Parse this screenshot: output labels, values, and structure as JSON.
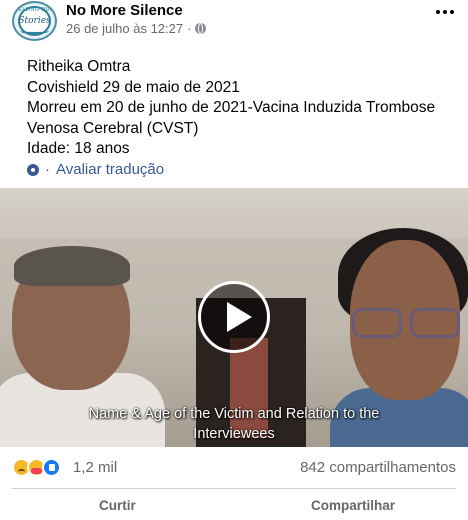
{
  "header": {
    "page_name": "No More Silence",
    "timestamp": "26 de julho às 12:27",
    "separator": "·",
    "avatar_logo_top": "TELLING OUR",
    "avatar_logo_text": "Stories",
    "audience_icon": "globe-icon",
    "menu_icon": "more-options-icon"
  },
  "post": {
    "lines": [
      "Ritheika Omtra",
      "Covishield 29 de maio de 2021",
      "Morreu em 20 de junho de 2021-Vacina Induzida Trombose",
      "Venosa Cerebral (CVST)",
      "Idade: 18 anos"
    ],
    "translate_icon": "gear-icon",
    "translate_separator": "·",
    "translate_label": "Avaliar tradução"
  },
  "video": {
    "caption_line1": "Name & Age of the Victim and Relation to the",
    "caption_line2": "Interviewees",
    "play_icon": "play-icon"
  },
  "stats": {
    "reaction_icons": [
      "sad-reaction-icon",
      "care-reaction-icon",
      "like-reaction-icon"
    ],
    "reaction_count": "1,2 mil",
    "shares": "842 compartilhamentos"
  },
  "actions": {
    "like_label": "Curtir",
    "share_label": "Compartilhar"
  },
  "colors": {
    "link": "#385898",
    "secondary_text": "#65676b",
    "like_blue": "#1877f2"
  }
}
